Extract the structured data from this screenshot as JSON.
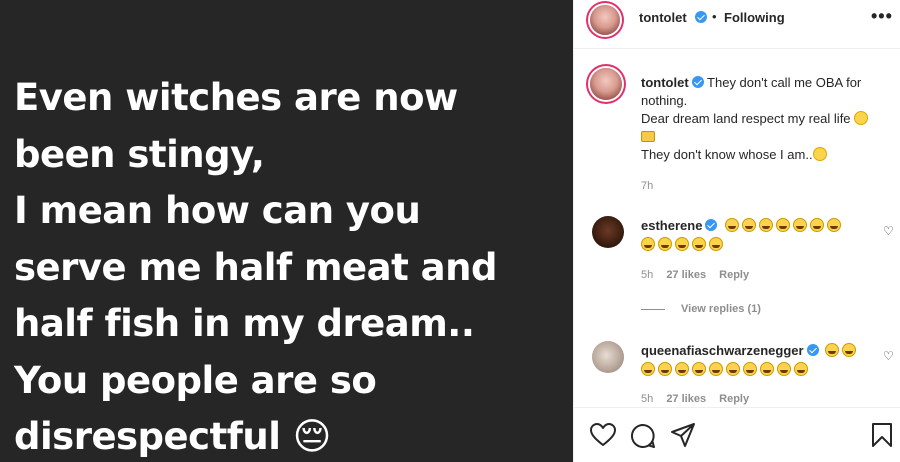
{
  "post": {
    "lines": [
      "Even witches are now",
      "been stingy,",
      "I mean how can you",
      "serve me half meat and",
      "half fish in my dream..",
      "You people are so",
      "disrespectful"
    ],
    "end_emoji": "😔"
  },
  "header": {
    "username": "tontolet",
    "dot": "•",
    "follow_status": "Following",
    "more": "•••"
  },
  "caption": {
    "username": "tontolet",
    "line1": "They don't call me OBA for nothing.",
    "line2": "Dear dream land respect my real life",
    "line3": "They don't know whose I am..",
    "time": "7h"
  },
  "comments": [
    {
      "username": "estherene",
      "emoji_count": 12,
      "time": "5h",
      "likes": "27 likes",
      "reply": "Reply"
    },
    {
      "username": "queenafiaschwarzenegger",
      "emoji_count": 12,
      "time": "5h",
      "likes": "27 likes",
      "reply": "Reply"
    }
  ],
  "view_replies": "View replies (1)",
  "icons": {
    "like": "heart-icon",
    "comment": "comment-icon",
    "share": "share-icon",
    "save": "bookmark-icon"
  },
  "colors": {
    "post_bg": "#262626",
    "verified": "#3897f0",
    "muted": "#8e8e8e"
  }
}
